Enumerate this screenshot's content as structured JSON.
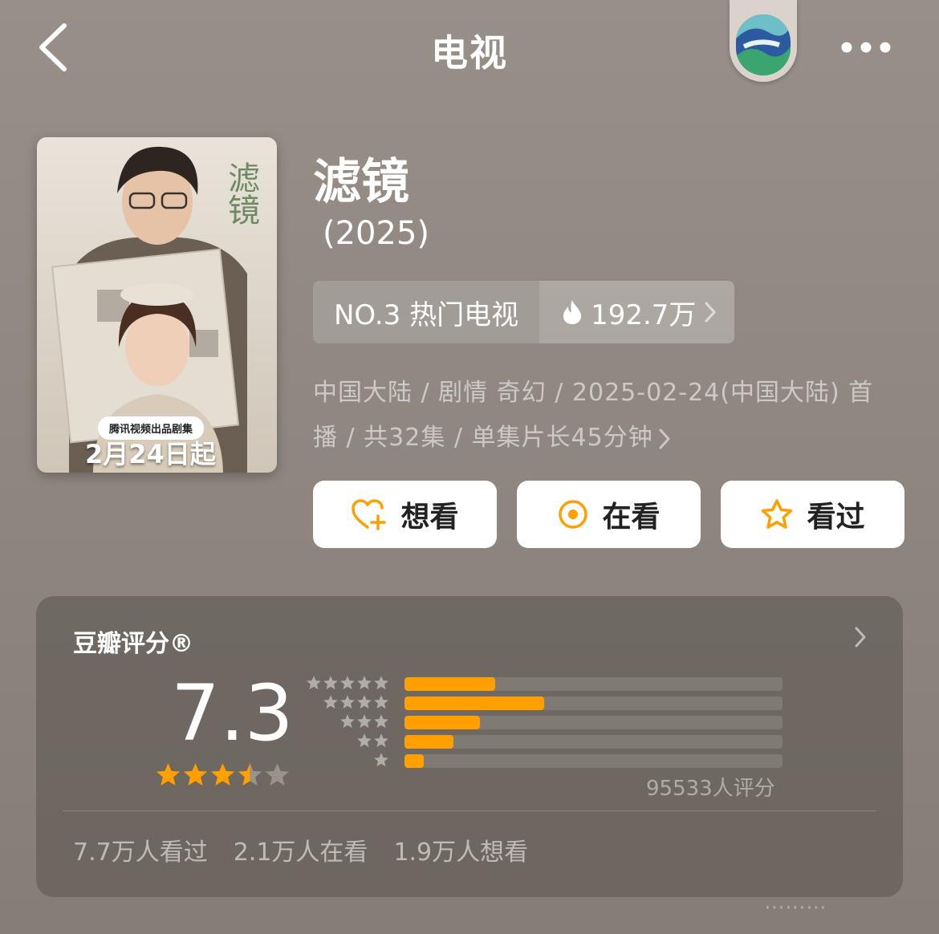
{
  "header": {
    "title": "电视"
  },
  "poster": {
    "badge": "腾讯视频出品剧集",
    "date": "2月24日起",
    "title": "滤镜"
  },
  "show": {
    "title": "滤镜",
    "year": "(2025)"
  },
  "rank": {
    "label": "NO.3 热门电视",
    "heat": "192.7万"
  },
  "meta": {
    "line1": "中国大陆 / 剧情 奇幻 / 2025-02-24(中国大陆) 首",
    "line2": "播 / 共32集 / 单集片长45分钟"
  },
  "actions": [
    {
      "label": "想看",
      "icon": "heart-plus-icon"
    },
    {
      "label": "在看",
      "icon": "watching-circle-icon"
    },
    {
      "label": "看过",
      "icon": "star-outline-icon"
    }
  ],
  "rating": {
    "heading": "豆瓣评分®",
    "score": "7.3",
    "stars": 3.5,
    "distribution": [
      {
        "stars": 5,
        "percent": 24
      },
      {
        "stars": 4,
        "percent": 37
      },
      {
        "stars": 3,
        "percent": 20
      },
      {
        "stars": 2,
        "percent": 13
      },
      {
        "stars": 1,
        "percent": 5
      }
    ],
    "count": "95533人评分",
    "stats": {
      "watched": "7.7万人看过",
      "watching": "2.1万人在看",
      "want": "1.9万人想看"
    }
  },
  "colors": {
    "accent": "#ff9f00",
    "star_empty": "#9a938d"
  }
}
